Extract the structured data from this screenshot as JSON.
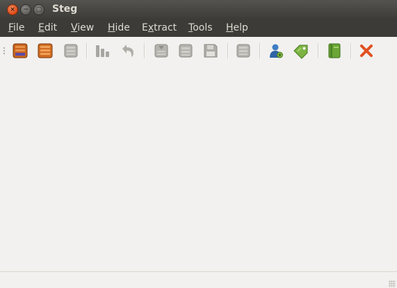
{
  "window": {
    "title": "Steg"
  },
  "window_buttons": {
    "close": "×",
    "minimize": "−",
    "maximize": "□"
  },
  "menubar": {
    "items": [
      {
        "pre": "",
        "u": "F",
        "post": "ile"
      },
      {
        "pre": "",
        "u": "E",
        "post": "dit"
      },
      {
        "pre": "",
        "u": "V",
        "post": "iew"
      },
      {
        "pre": "",
        "u": "H",
        "post": "ide"
      },
      {
        "pre": "E",
        "u": "x",
        "post": "tract"
      },
      {
        "pre": "",
        "u": "T",
        "post": "ools"
      },
      {
        "pre": "",
        "u": "H",
        "post": "elp"
      }
    ]
  },
  "toolbar": {
    "icons": [
      "open-image-icon",
      "open-crate-icon",
      "close-image-icon",
      "compare-icon",
      "undo-icon",
      "import-icon",
      "export-icon",
      "save-icon",
      "save-all-icon",
      "user-key-icon",
      "tag-icon",
      "book-icon",
      "exit-icon"
    ]
  },
  "colors": {
    "titlebar": "#3c3b37",
    "close_button": "#dd4814",
    "menu_text": "#dfdbd2",
    "exit_x": "#e05020"
  }
}
